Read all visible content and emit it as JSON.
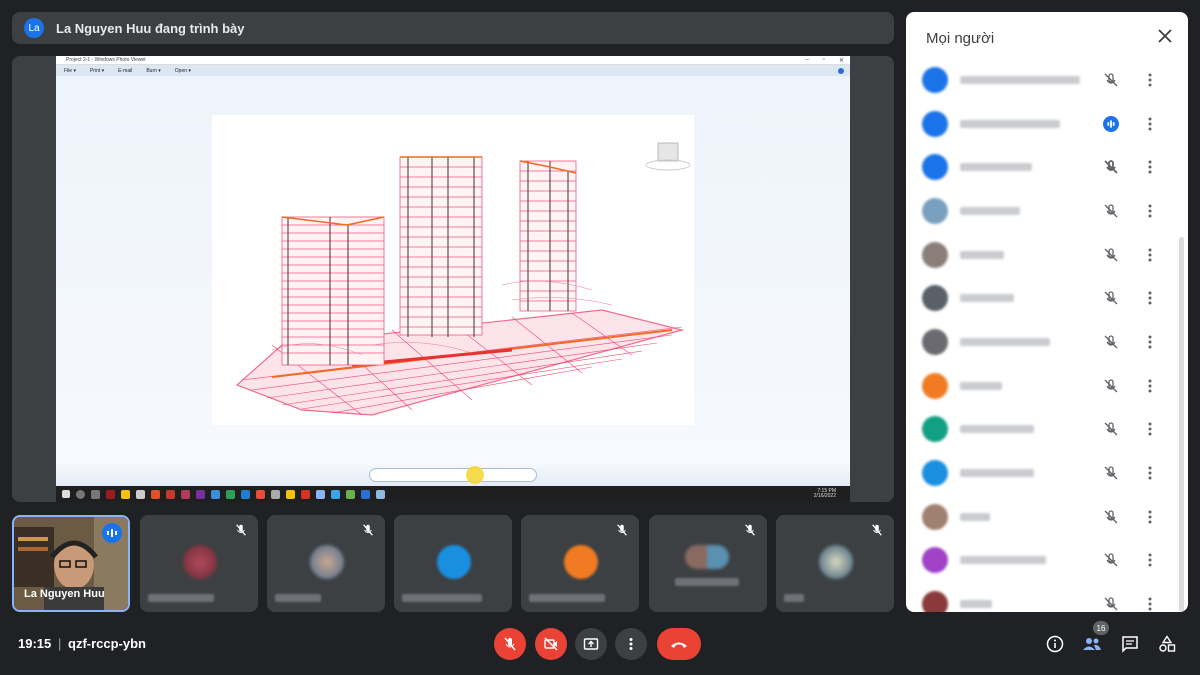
{
  "banner": {
    "avatar_initials": "La",
    "text": "La Nguyen Huu đang trình bày"
  },
  "shared_screen": {
    "window_title": "Project 2-1 - Windows Photo Viewer",
    "menu": [
      "File ▾",
      "Print ▾",
      "E-mail",
      "Burn ▾",
      "Open ▾"
    ],
    "clock_time": "7:15 PM",
    "clock_date": "2/16/2022"
  },
  "self_tile": {
    "name": "La Nguyen Huu"
  },
  "panel": {
    "title": "Mọi người"
  },
  "participants": [
    {
      "color": "#1a73e8",
      "mic": "muted"
    },
    {
      "color": "#1a73e8",
      "mic": "speaking"
    },
    {
      "color": "#1a73e8",
      "mic": "muted-bold"
    },
    {
      "color": "#7aa0c0",
      "mic": "muted"
    },
    {
      "color": "#8a7f78",
      "mic": "muted"
    },
    {
      "color": "#5a6068",
      "mic": "muted"
    },
    {
      "color": "#6a6a70",
      "mic": "muted"
    },
    {
      "color": "#f07b22",
      "mic": "muted"
    },
    {
      "color": "#12a085",
      "mic": "muted"
    },
    {
      "color": "#1a8fe0",
      "mic": "muted"
    },
    {
      "color": "#a08070",
      "mic": "muted"
    },
    {
      "color": "#a142c8",
      "mic": "muted"
    },
    {
      "color": "#8a3a3a",
      "mic": "muted"
    }
  ],
  "bottom": {
    "time": "19:15",
    "separator": "|",
    "meeting_code": "qzf-rccp-ybn",
    "people_count": "16"
  }
}
